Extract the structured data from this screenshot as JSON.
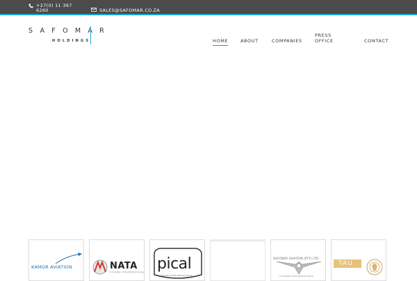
{
  "topbar": {
    "phone": "+27(0) 11 397 6260",
    "email": "SALES@SAFOMAR.CO.ZA",
    "accent_color": "#18a8d8",
    "phone_icon": "phone-icon",
    "email_icon": "envelope-icon"
  },
  "logo": {
    "top": "SAFOMAR",
    "bottom": "HOLDINGS"
  },
  "nav": {
    "items": [
      {
        "label": "HOME",
        "active": true
      },
      {
        "label": "ABOUT"
      },
      {
        "label": "COMPANIES"
      },
      {
        "label": "PRESS OFFICE"
      },
      {
        "label": "CONTACT"
      }
    ]
  },
  "companies": [
    {
      "name": "KAMOR AVIATION"
    },
    {
      "name": "NATA",
      "subtitle": "A member of the Safomar Group"
    },
    {
      "name": "pical",
      "subtitle": "A member of the Safomar Group"
    },
    {
      "name": ""
    },
    {
      "name": "SAFOMAR AVIATION (PTY) LTD",
      "subtitle": "A member of the Safomar Group"
    },
    {
      "name": "TAU"
    }
  ]
}
